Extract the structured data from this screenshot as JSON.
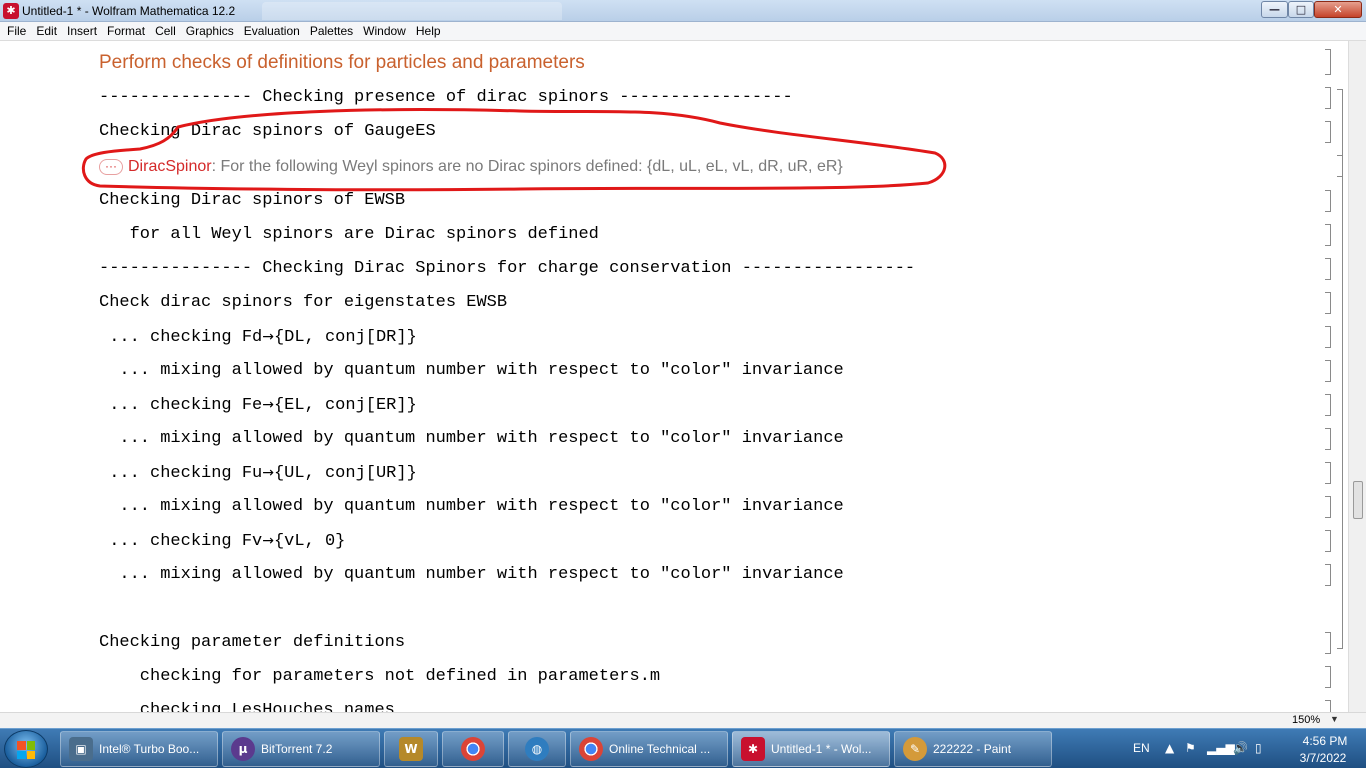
{
  "window": {
    "title": "Untitled-1 * - Wolfram Mathematica 12.2"
  },
  "menu": [
    "File",
    "Edit",
    "Insert",
    "Format",
    "Cell",
    "Graphics",
    "Evaluation",
    "Palettes",
    "Window",
    "Help"
  ],
  "notebook": {
    "section_title": "Perform checks of definitions for particles and parameters",
    "lines": {
      "l1": "--------------- Checking presence of dirac spinors -----------------",
      "l2": "Checking Dirac spinors of GaugeES",
      "l4": "Checking Dirac spinors of EWSB",
      "l5": "   for all Weyl spinors are Dirac spinors defined",
      "l6": "--------------- Checking Dirac Spinors for charge conservation -----------------",
      "l7": "Check dirac spinors for eigenstates EWSB",
      "mix": "  ... mixing allowed by quantum number with respect to \"color\" invariance",
      "l16": "Checking parameter definitions",
      "l17": "    checking for parameters not defined in parameters.m",
      "l18": "    checking LesHouches names"
    },
    "message": {
      "dots": "···",
      "name": "DiracSpinor",
      "text": ": For the following Weyl spinors are no Dirac spinors defined: {dL, uL, eL, vL, dR, uR, eR}"
    },
    "checks": [
      {
        "prefix": " ... checking ",
        "field": "Fd",
        "arrow": "→",
        "result": "{DL, conj[DR]}"
      },
      {
        "prefix": " ... checking ",
        "field": "Fe",
        "arrow": "→",
        "result": "{EL, conj[ER]}"
      },
      {
        "prefix": " ... checking ",
        "field": "Fu",
        "arrow": "→",
        "result": "{UL, conj[UR]}"
      },
      {
        "prefix": " ... checking ",
        "field": "Fv",
        "arrow": "→",
        "result": "{vL, 0}"
      }
    ]
  },
  "status": {
    "zoom": "150%"
  },
  "taskbar": {
    "items": [
      {
        "label": "Intel® Turbo Boo...",
        "icon": "intel-turbo-icon",
        "color": "#4a6d8c"
      },
      {
        "label": "BitTorrent 7.2",
        "icon": "bittorrent-icon",
        "color": "#5b3a8e"
      },
      {
        "label": "",
        "icon": "word-icon",
        "color": "#b5892a"
      },
      {
        "label": "",
        "icon": "chrome-icon",
        "color": "#3a9a45"
      },
      {
        "label": "",
        "icon": "globe-icon",
        "color": "#2f7dbf"
      },
      {
        "label": "Online Technical ...",
        "icon": "chrome-icon",
        "color": "#3a9a45"
      },
      {
        "label": "Untitled-1 * - Wol...",
        "icon": "mathematica-icon",
        "color": "#c8102e"
      },
      {
        "label": "222222 - Paint",
        "icon": "paint-icon",
        "color": "#d49a3a"
      }
    ],
    "language": "EN",
    "time": "4:56 PM",
    "date": "3/7/2022"
  },
  "colors": {
    "section_title": "#c9612e",
    "message_name": "#d42a2a",
    "annotation": "#e01818"
  }
}
